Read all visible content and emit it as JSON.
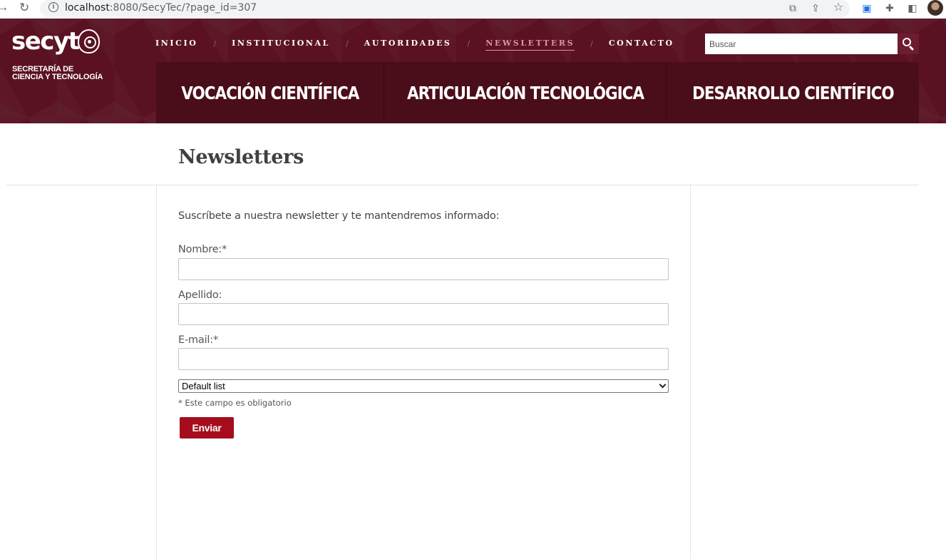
{
  "browser": {
    "url_host": "localhost",
    "url_rest": ":8080/SecyTec/?page_id=307"
  },
  "header": {
    "logo_text": "secyt",
    "logo_subtitle_line1": "SECRETARÍA DE",
    "logo_subtitle_line2": "CIENCIA Y TECNOLOGÍA",
    "nav": [
      {
        "label": "INICIO",
        "active": false
      },
      {
        "label": "INSTITUCIONAL",
        "active": false
      },
      {
        "label": "AUTORIDADES",
        "active": false
      },
      {
        "label": "NEWSLETTERS",
        "active": true
      },
      {
        "label": "CONTACTO",
        "active": false
      }
    ],
    "nav_separator": "/",
    "search_placeholder": "Buscar",
    "categories": [
      "VOCACIÓN CIENTÍFICA",
      "ARTICULACIÓN TECNOLÓGICA",
      "DESARROLLO CIENTÍFICO"
    ]
  },
  "page": {
    "title": "Newsletters"
  },
  "form": {
    "intro": "Suscríbete a nuestra newsletter y te mantendremos informado:",
    "name_label": "Nombre:*",
    "name_value": "",
    "surname_label": "Apellido:",
    "surname_value": "",
    "email_label": "E-mail:*",
    "email_value": "",
    "list_selected": "Default list",
    "required_note": "* Este campo es obligatorio",
    "submit_label": "Enviar"
  },
  "colors": {
    "header_bg": "#5a1222",
    "category_bg": "#4a0d1a",
    "active_nav": "#e2909c",
    "submit_bg": "#a50d1d"
  }
}
